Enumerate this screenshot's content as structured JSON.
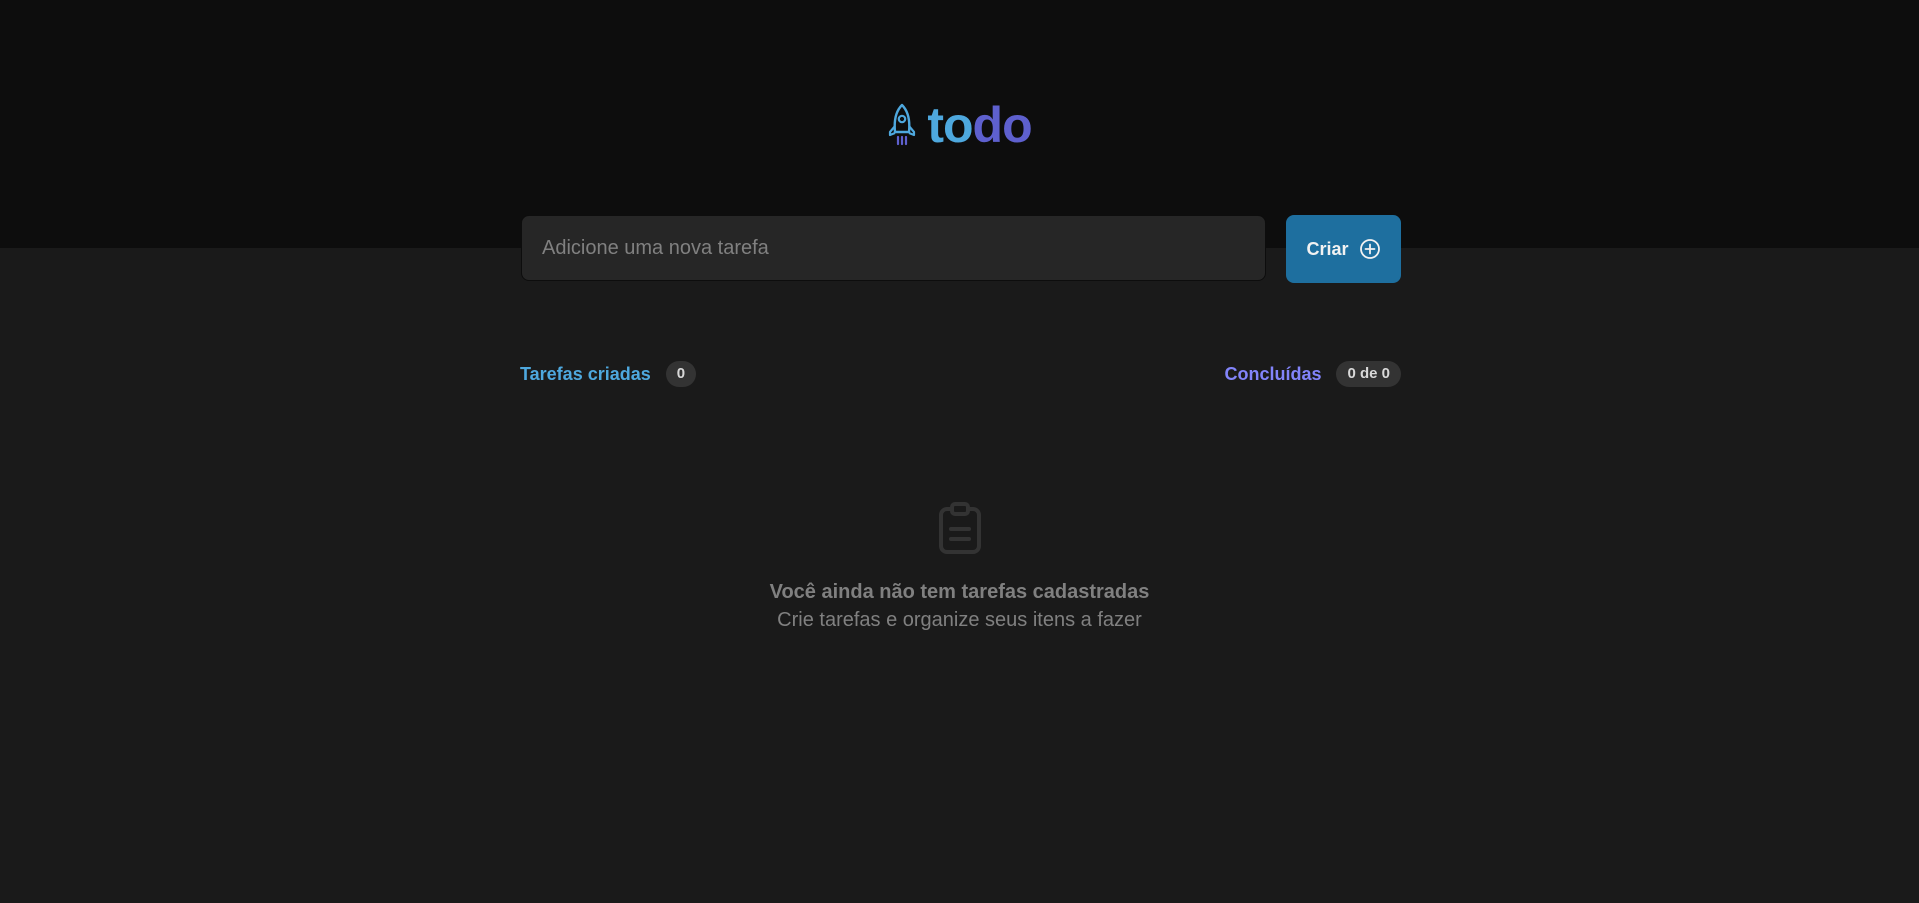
{
  "app": {
    "logo_part1": "to",
    "logo_part2": "do",
    "logo_icon": "rocket-icon"
  },
  "colors": {
    "blue": "#4ea8de",
    "purple": "#5e60ce",
    "purple_light": "#8284fa",
    "button": "#1e6f9f",
    "header_bg": "#0d0d0d",
    "body_bg": "#1a1a1a"
  },
  "new_task": {
    "placeholder": "Adicione uma nova tarefa",
    "value": "",
    "create_label": "Criar",
    "create_icon": "plus-circle-icon"
  },
  "info": {
    "created_label": "Tarefas criadas",
    "created_count": "0",
    "done_label": "Concluídas",
    "done_count": "0 de 0"
  },
  "empty": {
    "icon": "clipboard-icon",
    "title": "Você ainda não tem tarefas cadastradas",
    "subtitle": "Crie tarefas e organize seus itens a fazer"
  }
}
